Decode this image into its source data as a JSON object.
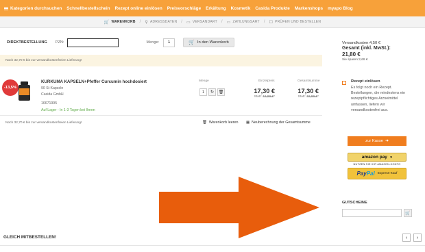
{
  "nav": {
    "items": [
      {
        "label": "Kategorien durchsuchen"
      },
      {
        "label": "Schnellbestellschein"
      },
      {
        "label": "Rezept online einlösen"
      },
      {
        "label": "Preisvorschläge"
      },
      {
        "label": "Erkältung"
      },
      {
        "label": "Kosmetik"
      },
      {
        "label": "Casida Produkte"
      },
      {
        "label": "Markenshops"
      },
      {
        "label": "myapo Blog"
      }
    ]
  },
  "steps": {
    "items": [
      {
        "label": "WARENKORB",
        "icon": "cart-icon"
      },
      {
        "label": "ADRESSDATEN",
        "icon": "location-icon"
      },
      {
        "label": "VERSANDART",
        "icon": "truck-icon"
      },
      {
        "label": "ZAHLUNGSART",
        "icon": "card-icon"
      },
      {
        "label": "PRÜFEN UND BESTELLEN",
        "icon": "check-icon"
      }
    ]
  },
  "direct": {
    "label": "DIREKTBESTELLUNG",
    "pzn_label": "PZN:",
    "pzn_value": "",
    "menge_label": "Menge:",
    "qty": "1",
    "add_label": "In den Warenkorb"
  },
  "notice": "Noch 32,70 € bis zur versandkostenfreien Lieferung!",
  "product": {
    "discount": "-13,5%",
    "name": "KURKUMA KAPSELN+Pfeffer Curcumin hochdosiert",
    "size": "90 St Kapseln",
    "maker": "Casida GmbH",
    "pzn": "16671995",
    "availability": "Auf Lager - In 1-3 Tagen bei Ihnen",
    "menge_head": "Menge",
    "unit_head": "Einzelpreis",
    "total_head": "Gesamtsumme",
    "qty": "1",
    "unit_price": "17,30 €",
    "total_price": "17,30 €",
    "statt_label": "Statt:",
    "old_unit": "19,99 €",
    "old_total": "19,99 €",
    "star": "*"
  },
  "cart_footer": {
    "notice": "Noch 32,70 € bis zur versandkostenfreien Lieferung!",
    "clear": "Warenkorb leeren",
    "recalc": "Neuberechnung der Gesamtsumme"
  },
  "summary": {
    "shipping": "Versandkosten:4,50 €",
    "total_label": "Gesamt (inkl. MwSt.):",
    "total": "21,80 €",
    "saved": "Sie sparen:2,69 €"
  },
  "rezept": {
    "title": "Rezept einlösen",
    "desc": "Es folgt noch ein Rezept. Bestellungen, die mindestens ein rezeptpflichtiges Arzneimittel umfassen, liefern wir versandkostenfrei aus."
  },
  "checkout": {
    "kasse": "zur Kasse",
    "amazon": "amazon pay",
    "amazon_sub": "NUTZEN SIE IHR AMAZON-KONTO",
    "paypal_a": "Pay",
    "paypal_b": "Pal",
    "paypal_sub": "Express-Kauf"
  },
  "coupon": {
    "title": "GUTSCHEINE",
    "value": ""
  },
  "bottom": {
    "title": "GLEICH MITBESTELLEN!"
  },
  "colors": {
    "nav": "#f7a13a",
    "accent": "#f07d1e",
    "arrow": "#e85d0c",
    "badge": "#e03a3a",
    "stock": "#5ca945"
  }
}
